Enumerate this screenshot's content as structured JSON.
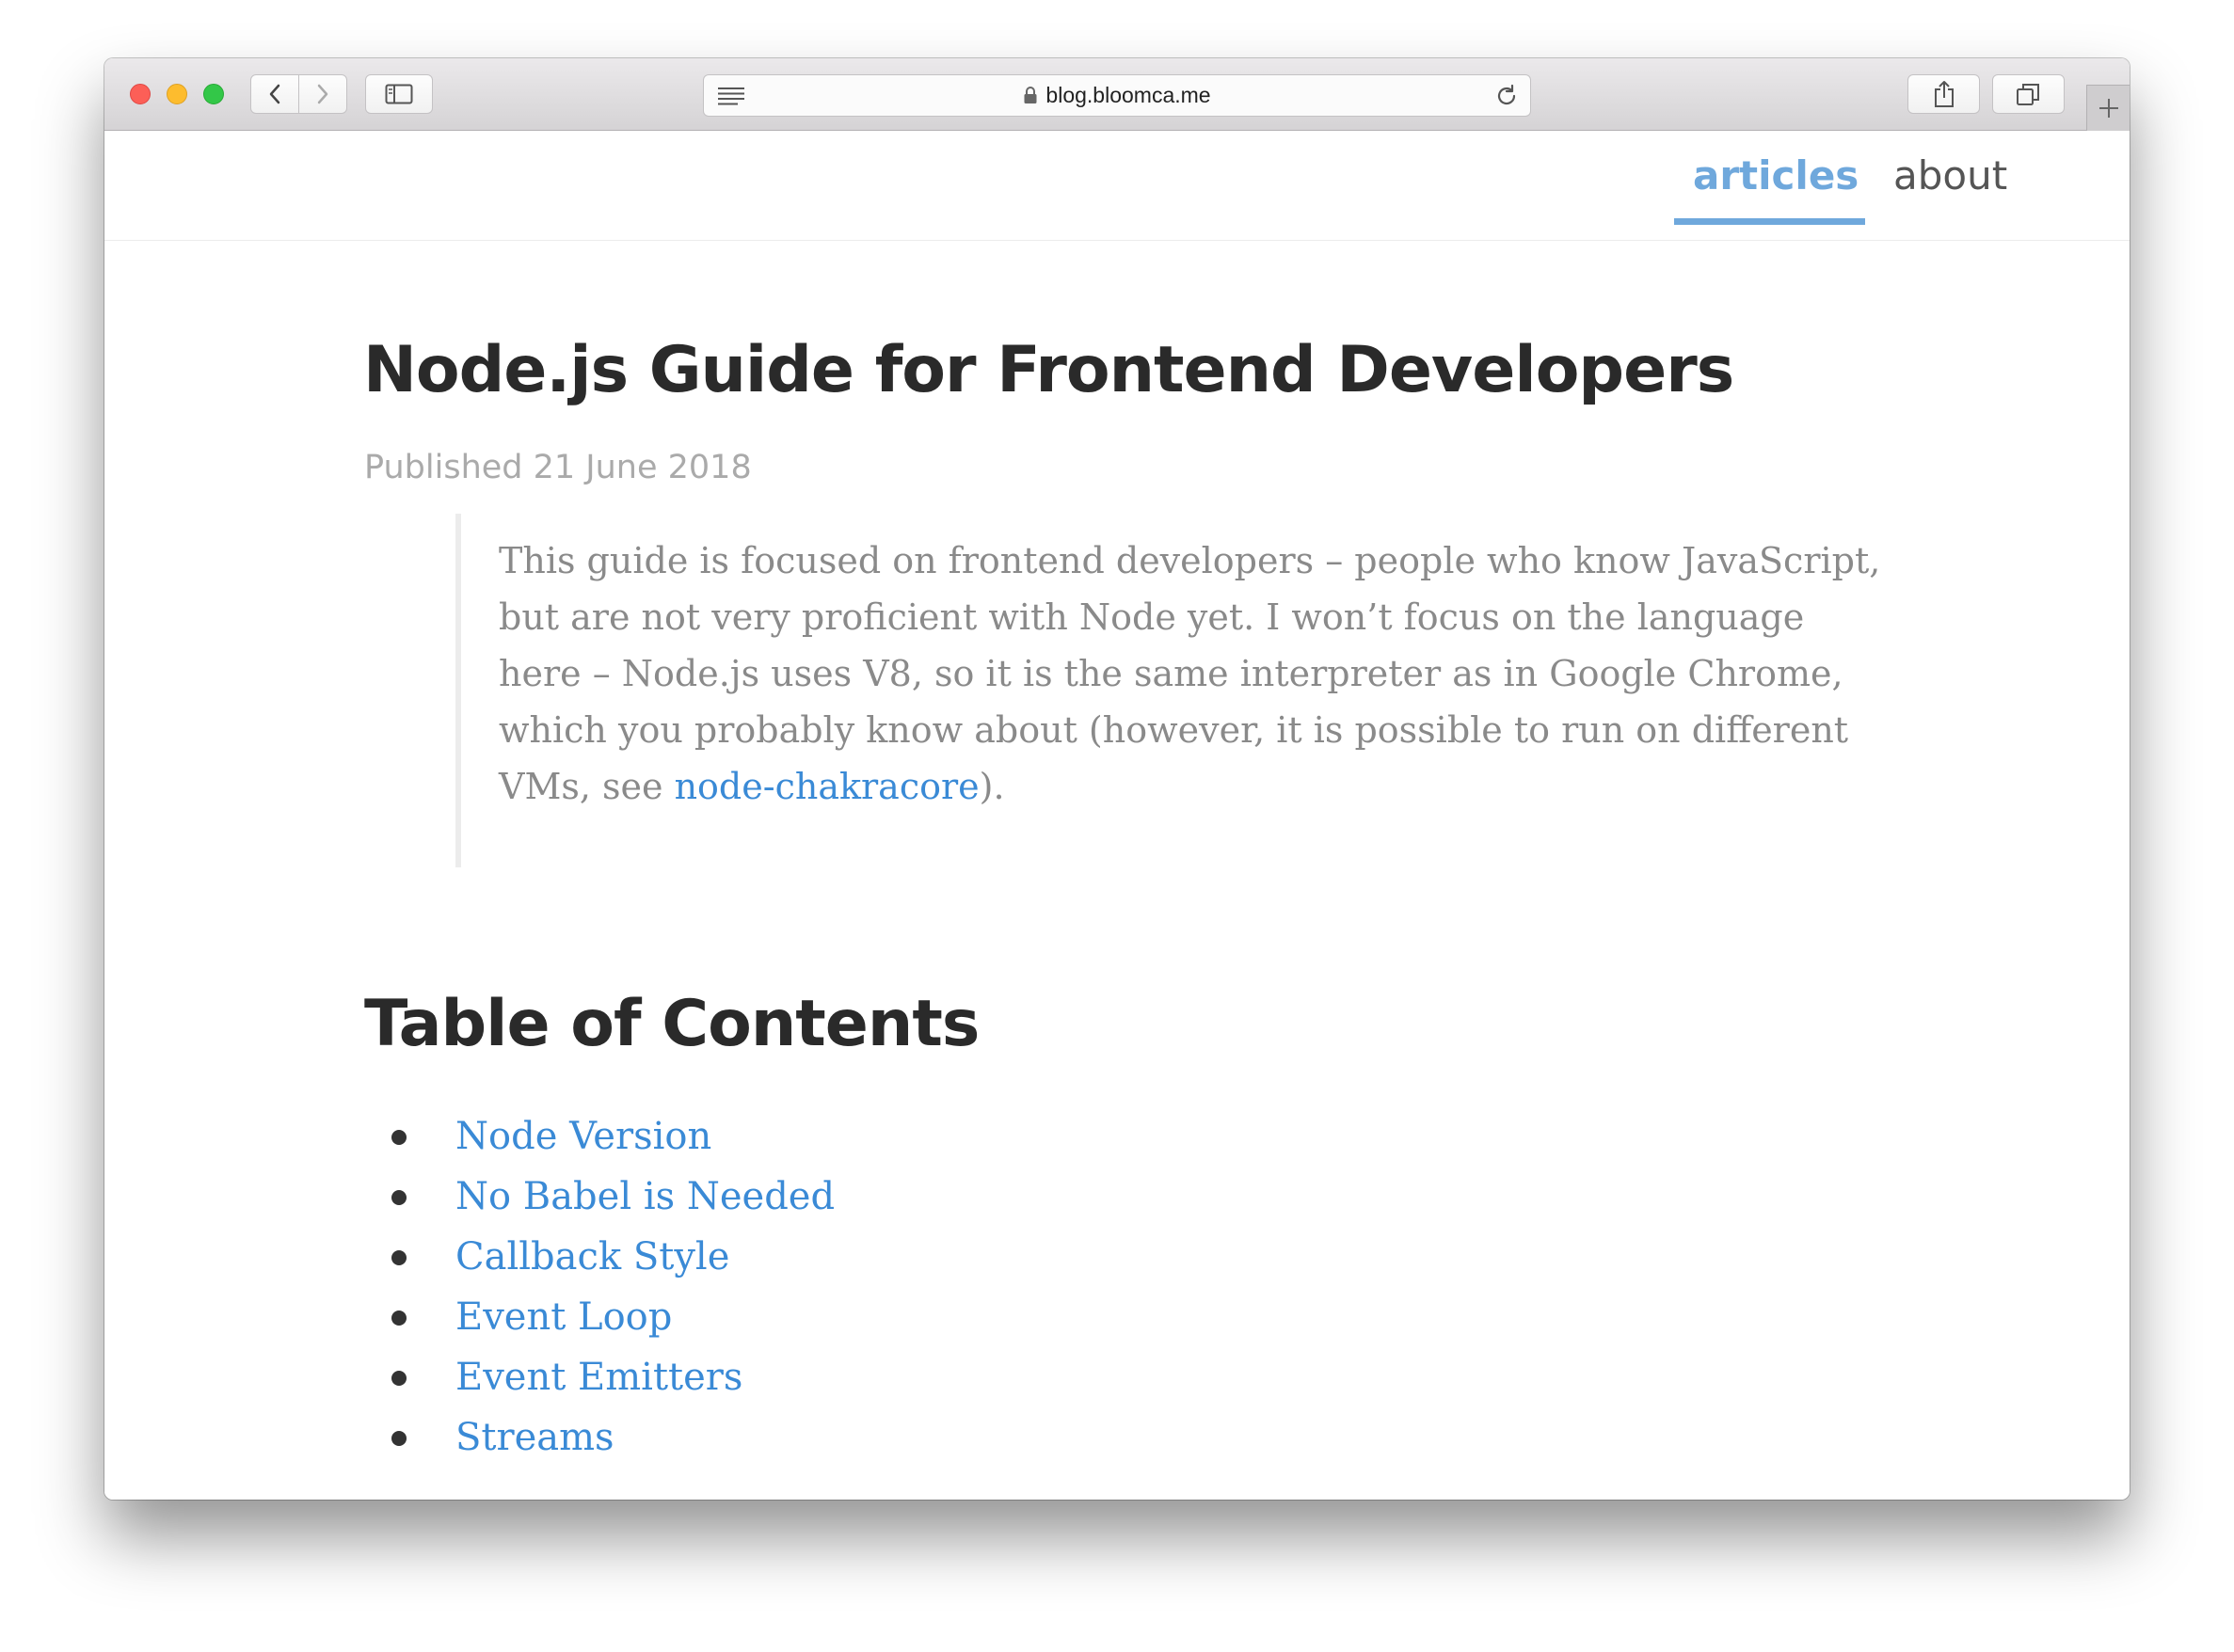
{
  "browser": {
    "url": "blog.bloomca.me"
  },
  "site_nav": {
    "items": [
      {
        "label": "articles",
        "active": true
      },
      {
        "label": "about",
        "active": false
      }
    ]
  },
  "post": {
    "title": "Node.js Guide for Frontend Developers",
    "date": "Published 21 June 2018",
    "intro": {
      "lines": [
        "This guide is focused on frontend developers – people who know JavaScript,",
        "but are not very proficient with Node yet. I won’t focus on the language",
        "here – Node.js uses V8, so it is the same interpreter as in Google Chrome,",
        "which you probably know about (however, it is possible to run on different"
      ],
      "last_line_prefix": "VMs, see ",
      "last_line_link": "node-chakracore",
      "last_line_suffix": ")."
    }
  },
  "toc": {
    "title": "Table of Contents",
    "items": [
      "Node Version",
      "No Babel is Needed",
      "Callback Style",
      "Event Loop",
      "Event Emitters",
      "Streams"
    ]
  },
  "colors": {
    "accent": "#6fa8dc",
    "link": "#3a8ad6",
    "heading": "#2a2a2a",
    "muted": "#8a8a8a"
  }
}
